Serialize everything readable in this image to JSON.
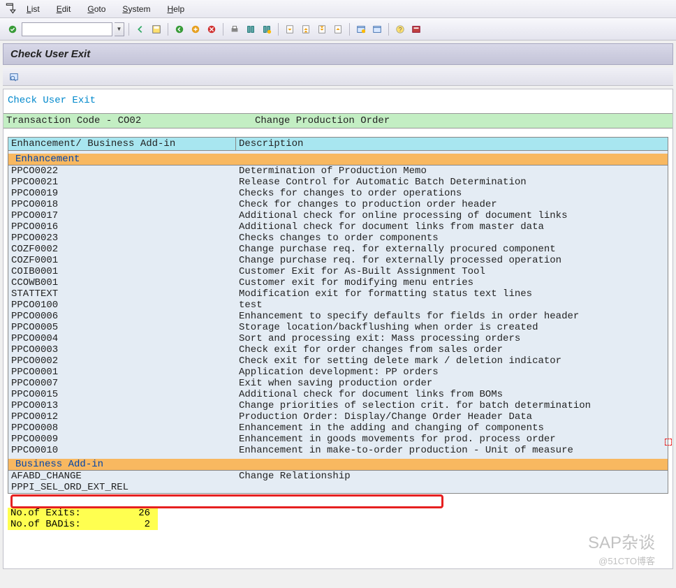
{
  "menubar": {
    "items": [
      {
        "u": "L",
        "rest": "ist"
      },
      {
        "u": "E",
        "rest": "dit"
      },
      {
        "u": "G",
        "rest": "oto"
      },
      {
        "u": "S",
        "rest": "ystem"
      },
      {
        "u": "H",
        "rest": "elp"
      }
    ]
  },
  "title": "Check User Exit",
  "report_title": "Check User Exit",
  "transaction": {
    "left": "Transaction Code - CO02",
    "right": "Change Production Order"
  },
  "columns": {
    "c1": "Enhancement/ Business Add-in",
    "c2": "Description"
  },
  "section_enh": " Enhancement",
  "section_badi": " Business Add-in",
  "enh_rows": [
    {
      "c1": "PPCO0022",
      "c2": "Determination of Production Memo"
    },
    {
      "c1": "PPCO0021",
      "c2": "Release Control for Automatic Batch Determination"
    },
    {
      "c1": "PPCO0019",
      "c2": "Checks for changes to order operations"
    },
    {
      "c1": "PPCO0018",
      "c2": "Check for changes to production order header"
    },
    {
      "c1": "PPCO0017",
      "c2": "Additional check for online processing of document links"
    },
    {
      "c1": "PPCO0016",
      "c2": "Additional check for document links from master data"
    },
    {
      "c1": "PPCO0023",
      "c2": "Checks changes to order components"
    },
    {
      "c1": "COZF0002",
      "c2": "Change purchase req. for externally procured component"
    },
    {
      "c1": "COZF0001",
      "c2": "Change purchase req. for externally processed operation"
    },
    {
      "c1": "COIB0001",
      "c2": "Customer Exit for As-Built Assignment Tool"
    },
    {
      "c1": "CCOWB001",
      "c2": "Customer exit for modifying menu entries"
    },
    {
      "c1": "STATTEXT",
      "c2": "Modification exit for formatting status text lines"
    },
    {
      "c1": "PPCO0100",
      "c2": "test"
    },
    {
      "c1": "PPCO0006",
      "c2": "Enhancement to specify defaults for fields in order header"
    },
    {
      "c1": "PPCO0005",
      "c2": "Storage location/backflushing when order is created"
    },
    {
      "c1": "PPCO0004",
      "c2": "Sort and processing exit: Mass processing orders"
    },
    {
      "c1": "PPCO0003",
      "c2": "Check exit for order changes from sales order"
    },
    {
      "c1": "PPCO0002",
      "c2": "Check exit for setting delete mark / deletion indicator"
    },
    {
      "c1": "PPCO0001",
      "c2": "Application development: PP orders"
    },
    {
      "c1": "PPCO0007",
      "c2": "Exit when saving production order"
    },
    {
      "c1": "PPCO0015",
      "c2": "Additional check for document links from BOMs"
    },
    {
      "c1": "PPCO0013",
      "c2": "Change priorities of selection crit. for batch determination"
    },
    {
      "c1": "PPCO0012",
      "c2": "Production Order: Display/Change Order Header Data"
    },
    {
      "c1": "PPCO0008",
      "c2": "Enhancement in the adding and changing of components"
    },
    {
      "c1": "PPCO0009",
      "c2": "Enhancement in goods movements for prod. process order"
    },
    {
      "c1": "PPCO0010",
      "c2": "Enhancement in make-to-order production - Unit of measure"
    }
  ],
  "badi_rows": [
    {
      "c1": "AFABD_CHANGE",
      "c2": "Change Relationship"
    },
    {
      "c1": "PPPI_SEL_ORD_EXT_REL",
      "c2": ""
    }
  ],
  "summary": [
    {
      "s1": "No.of Exits:",
      "s2": "26"
    },
    {
      "s1": "No.of BADis:",
      "s2": "2"
    }
  ],
  "watermark1": "SAP杂谈",
  "watermark2": "@51CTO博客"
}
